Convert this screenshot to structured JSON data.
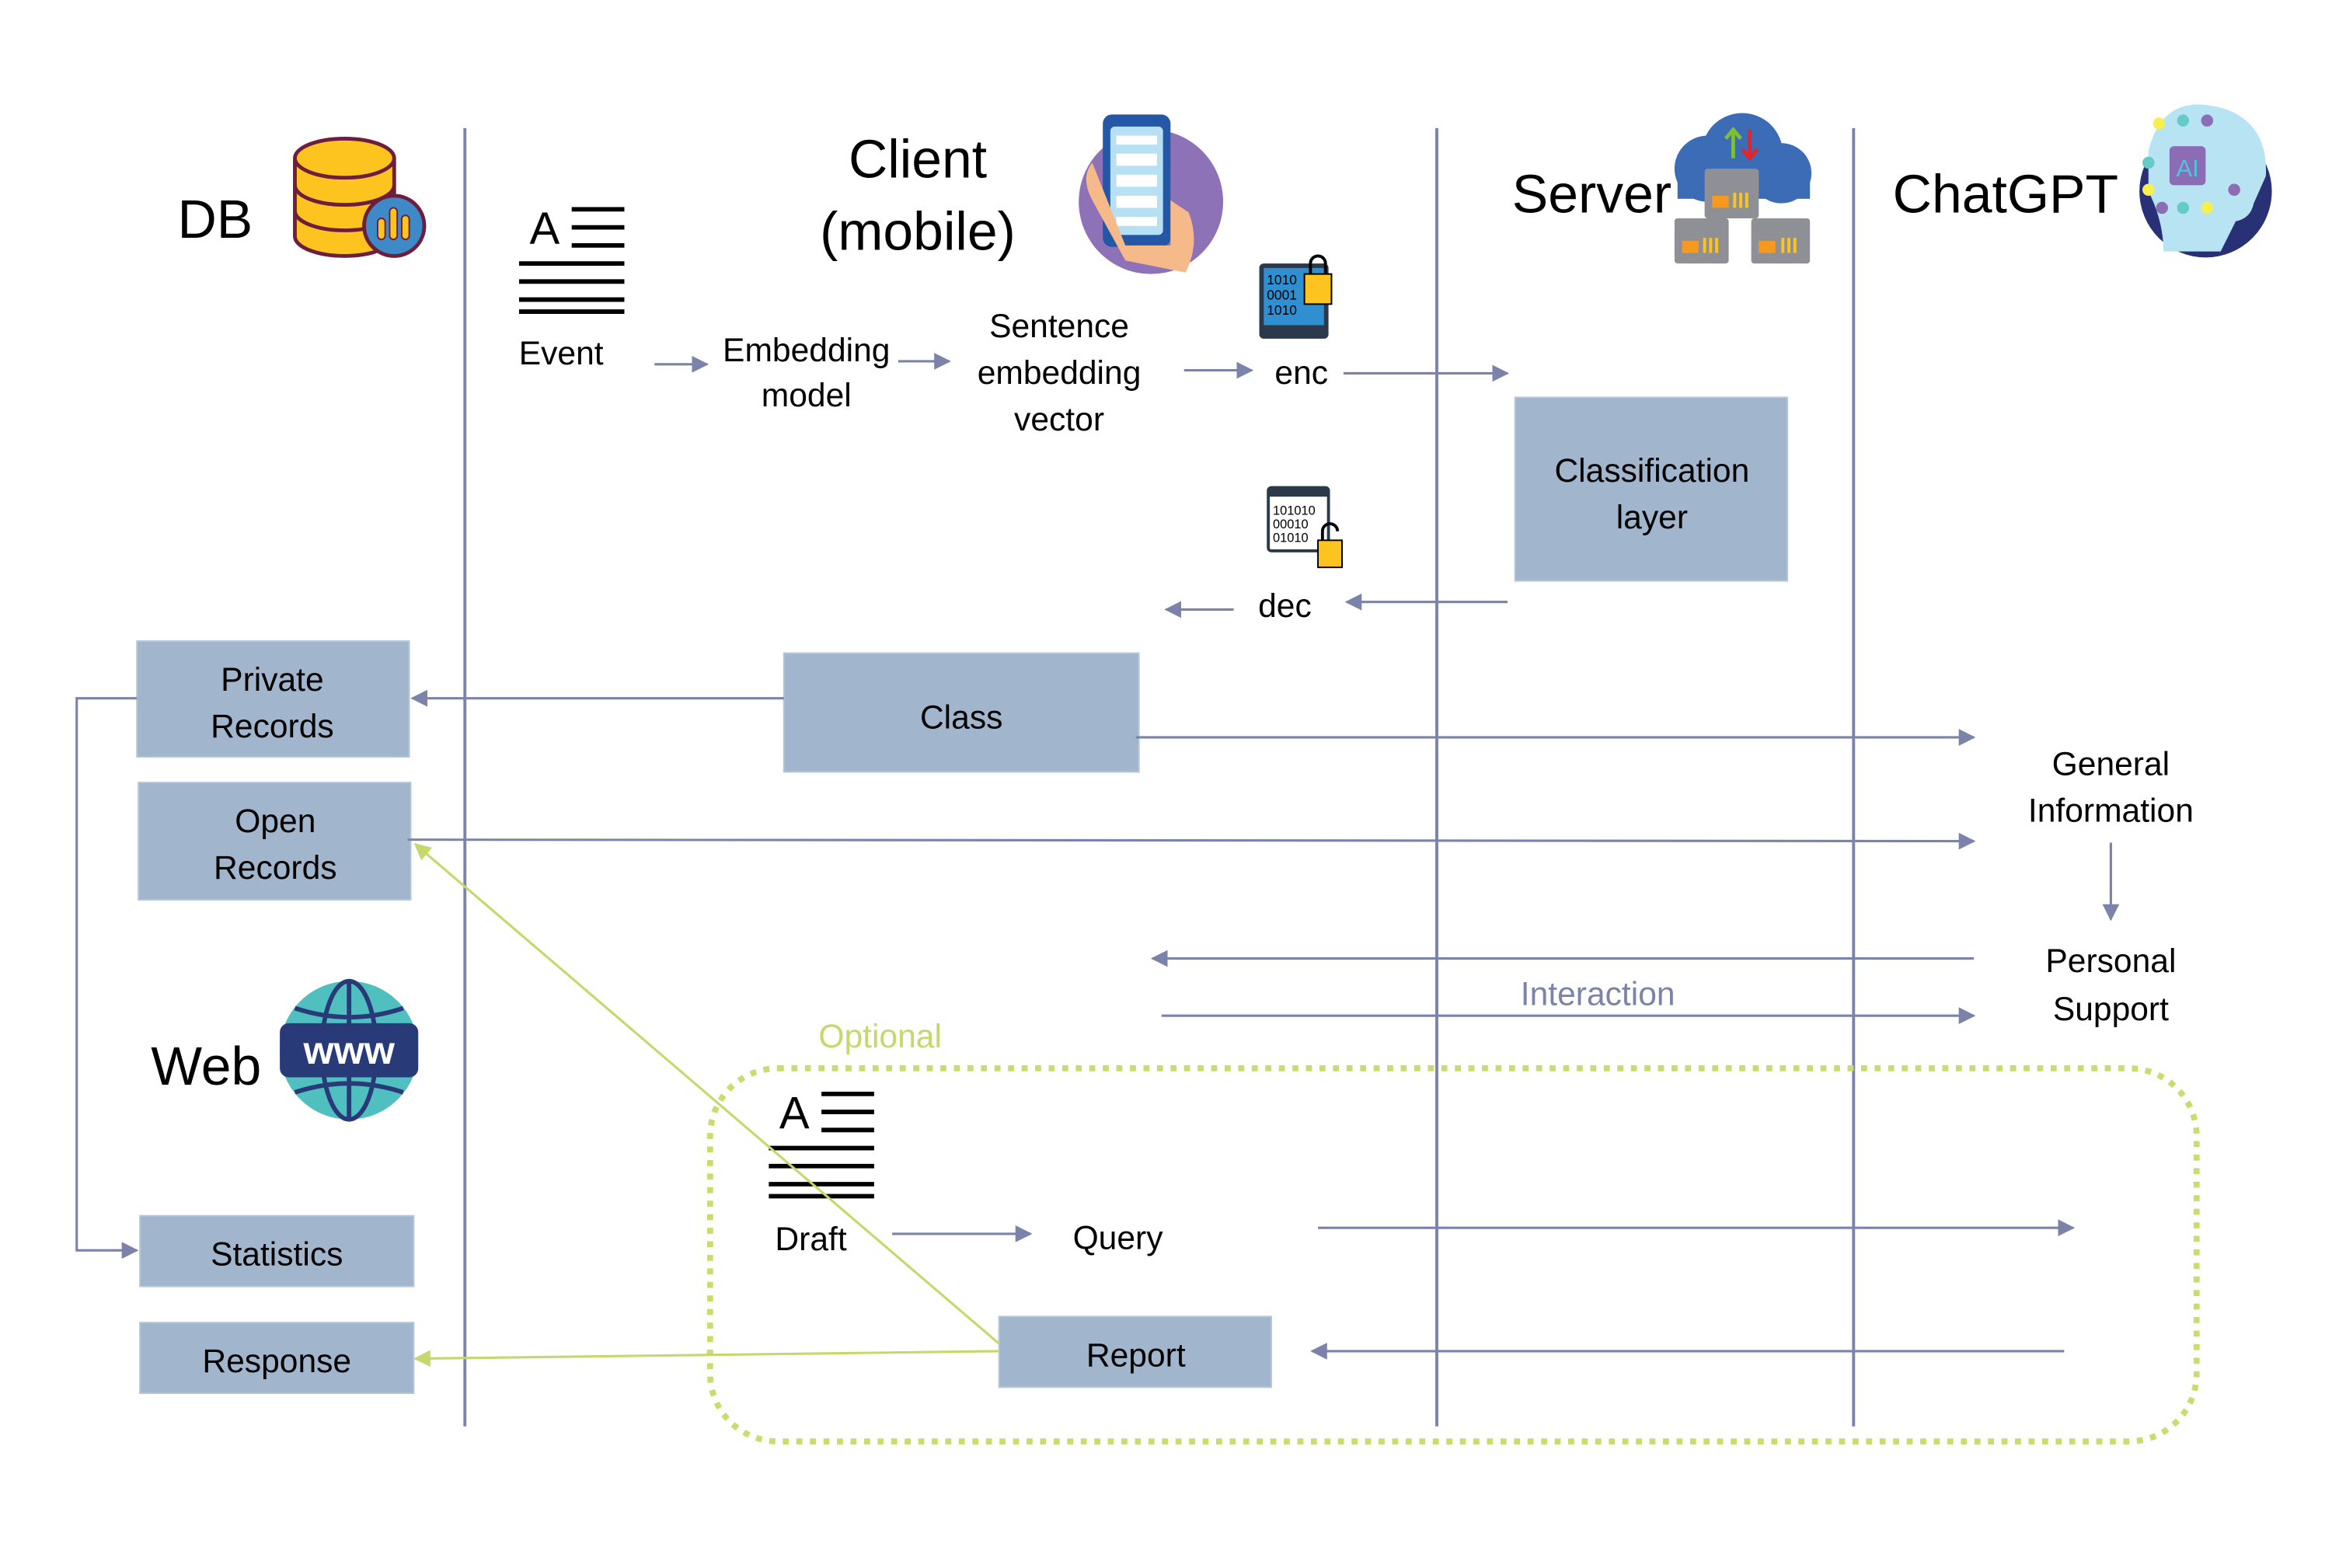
{
  "lanes": {
    "db": "DB",
    "client_line1": "Client",
    "client_line2": "(mobile)",
    "server": "Server",
    "chatgpt": "ChatGPT",
    "web": "Web"
  },
  "flow": {
    "event": "Event",
    "embedding_line1": "Embedding",
    "embedding_line2": "model",
    "sentence_line1": "Sentence",
    "sentence_line2": "embedding",
    "sentence_line3": "vector",
    "enc": "enc",
    "dec": "dec",
    "classification_line1": "Classification",
    "classification_line2": "layer",
    "class": "Class",
    "general_line1": "General",
    "general_line2": "Information",
    "personal_line1": "Personal",
    "personal_line2": "Support",
    "interaction": "Interaction"
  },
  "db_boxes": {
    "private_line1": "Private",
    "private_line2": "Records",
    "open_line1": "Open",
    "open_line2": "Records",
    "statistics": "Statistics",
    "response": "Response"
  },
  "optional": {
    "label": "Optional",
    "draft": "Draft",
    "query": "Query",
    "report": "Report"
  },
  "icons": {
    "enc_code": [
      "1010",
      "0001",
      "1010"
    ],
    "dec_code": [
      "101010",
      "00010",
      "01010"
    ],
    "web_icon_text": "www",
    "chatgpt_icon_text": "AI"
  },
  "colors": {
    "box": "#a1b6cd",
    "line": "#7b83ab",
    "optional": "#c5d86b"
  }
}
